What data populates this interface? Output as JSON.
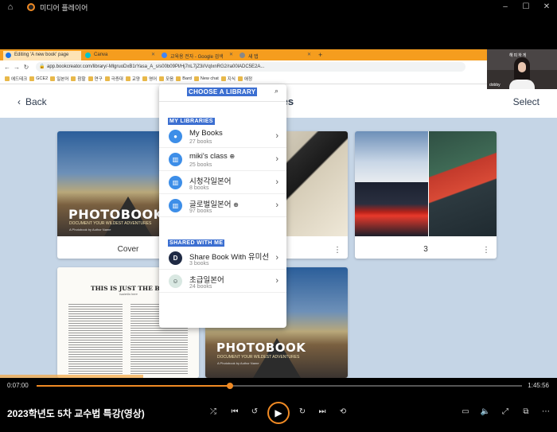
{
  "player": {
    "app_title": "미디어 플레이어",
    "media_title": "2023학년도 5차 교수법 특강(영상)",
    "time_elapsed": "0:07:00",
    "time_total": "1:45:56",
    "progress_fraction": 0.398
  },
  "browser": {
    "tabs": [
      {
        "label": "Editing 'A new book' page",
        "color": "#1a73e8",
        "active": true
      },
      {
        "label": "Canva",
        "color": "#00c4cc",
        "active": false
      },
      {
        "label": "교육용 전자 - Google 검색",
        "color": "#4285f4",
        "active": false
      },
      {
        "label": "새 탭",
        "color": "#888888",
        "active": false
      }
    ],
    "url": "app.bookcreator.com/library/-MlgruoDxB1rYasa_A_s/s00b09Pl/Hj7nL7jZ3i/VqIxnRG2/ra00lADC5E2A...",
    "bookmarks": [
      "에드테크",
      "GCE2",
      "일본어",
      "참할",
      "연구",
      "극증대",
      "교양",
      "영어",
      "모음",
      "Bard",
      "New chat",
      "지식",
      "애정"
    ]
  },
  "webcam": {
    "name": "dobby",
    "banner": "해피하게"
  },
  "pages_view": {
    "back_label": "Back",
    "title": "Pages",
    "select_label": "Select",
    "cards": [
      {
        "label": "Cover",
        "cover_title": "PHOTOBOOK",
        "cover_subtitle": "DOCUMENT YOUR WILDEST ADVENTURES",
        "byline": "A Photobook by Author Name"
      },
      {
        "label": "3"
      }
    ],
    "spread_heading": "THIS IS JUST THE BEGINNING",
    "spread_byline": "Isabella here",
    "second_cover_title": "PHOTOBOOK",
    "second_cover_subtitle": "DOCUMENT YOUR WILDEST ADVENTURES",
    "second_cover_byline": "A Photobook by Author Name"
  },
  "library_menu": {
    "header": "CHOOSE A LIBRARY",
    "my_section": "MY LIBRARIES",
    "shared_section": "SHARED WITH ME",
    "my_libraries": [
      {
        "name": "My Books",
        "count": "27 books",
        "icon": "person-icon",
        "globe": false
      },
      {
        "name": "miki's class",
        "count": "25 books",
        "icon": "books-icon",
        "globe": true
      },
      {
        "name": "시청각일본어",
        "count": "8 books",
        "icon": "books-icon",
        "globe": false
      },
      {
        "name": "글로벌일본어",
        "count": "97 books",
        "icon": "books-icon",
        "globe": true
      }
    ],
    "shared_libraries": [
      {
        "name": "Share Book With 유미선",
        "count": "3 books",
        "initial": "D"
      },
      {
        "name": "초급일본어",
        "count": "24 books",
        "initial": ""
      }
    ]
  }
}
